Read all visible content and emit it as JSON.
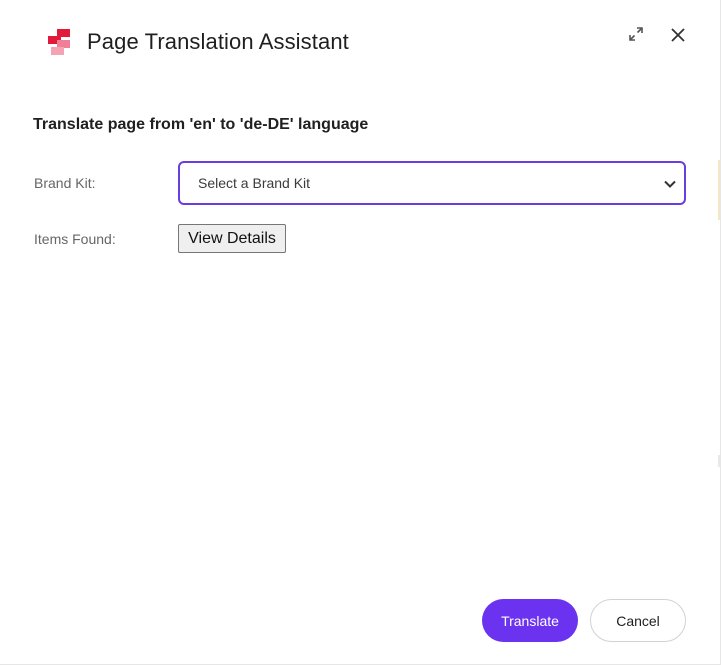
{
  "dialog": {
    "title": "Page Translation Assistant",
    "logo_icon": "sitecore-logo-icon",
    "header_actions": [
      {
        "icon": "expand-icon"
      },
      {
        "icon": "close-icon"
      }
    ]
  },
  "body": {
    "subheading": "Translate page from 'en' to 'de-DE' language",
    "brand_kit": {
      "label": "Brand Kit:",
      "selected_value": "Select a Brand Kit",
      "dropdown_icon": "chevron-down-icon"
    },
    "items_found": {
      "label": "Items Found:",
      "button_label": "View Details"
    }
  },
  "footer": {
    "translate_label": "Translate",
    "cancel_label": "Cancel"
  },
  "colors": {
    "accent": "#6b33ef",
    "select_border": "#6b3ce0",
    "logo_red": "#e3193a",
    "logo_pink": "#f4a3b2"
  }
}
